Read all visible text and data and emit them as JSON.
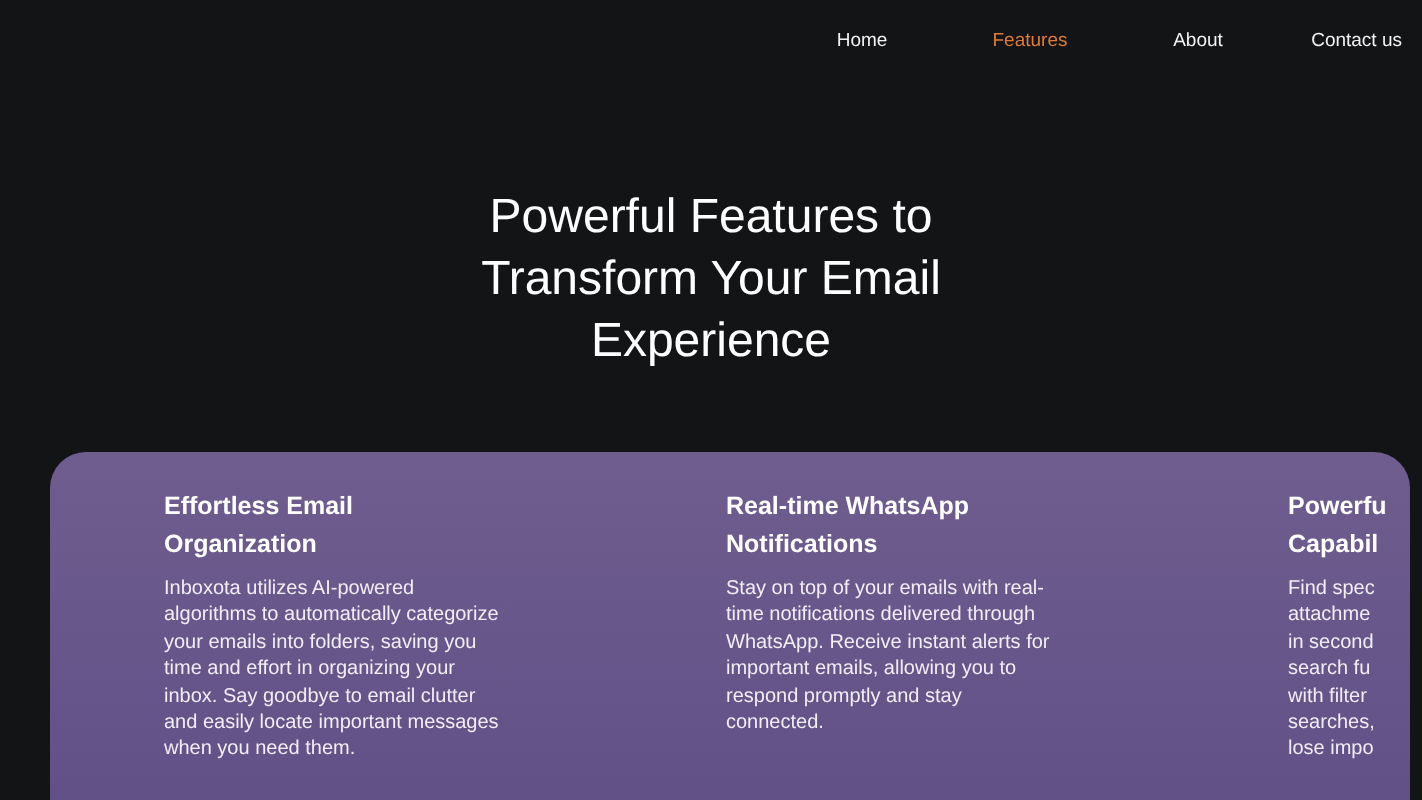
{
  "nav": [
    {
      "label": "Home",
      "selected": false
    },
    {
      "label": "Features",
      "selected": true
    },
    {
      "label": "About",
      "selected": false
    },
    {
      "label": "Contact us",
      "selected": false
    }
  ],
  "hero": {
    "title": "Powerful Features to Transform Your Email Experience"
  },
  "features": [
    {
      "title": "Effortless Email Organization",
      "description": "Inboxota utilizes AI-powered algorithms to automatically categorize your emails into folders, saving you time and effort in organizing your inbox. Say goodbye to email clutter and easily locate important messages when you need them."
    },
    {
      "title": "Real-time WhatsApp Notifications",
      "description": "Stay on top of your emails with real-time notifications delivered through WhatsApp. Receive instant alerts for important emails, allowing you to respond promptly and stay connected."
    },
    {
      "title": "Powerfu\nCapabil",
      "description": "Find spec\nattachme\nin second\nsearch fu\nwith filter\nsearches,\nlose impo"
    }
  ]
}
